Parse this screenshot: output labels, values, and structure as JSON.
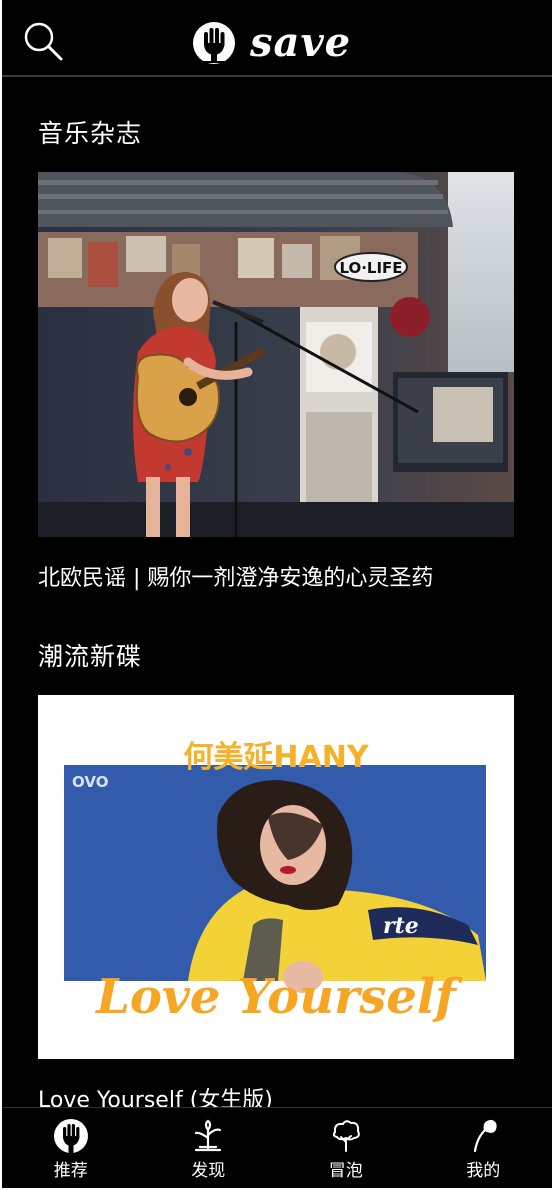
{
  "header": {
    "logo_text": "save",
    "search_icon": "search-icon",
    "logo_icon": "hand-logo-icon"
  },
  "sections": [
    {
      "title": "音乐杂志",
      "caption": "北欧民谣 | 赐你一剂澄净安逸的心灵圣药",
      "image_sign": "LO·LIFE"
    },
    {
      "title": "潮流新碟",
      "caption": "Love Yourself (女生版)",
      "cover_artist": "何美延HANY",
      "cover_title": "Love Yourself",
      "cover_badge": "OVO"
    }
  ],
  "tabbar": {
    "items": [
      {
        "label": "推荐",
        "icon": "hand-logo-icon"
      },
      {
        "label": "发现",
        "icon": "sprout-icon"
      },
      {
        "label": "冒泡",
        "icon": "tree-icon"
      },
      {
        "label": "我的",
        "icon": "leaf-icon"
      }
    ]
  },
  "colors": {
    "background": "#000000",
    "text": "#ffffff",
    "cover_yellow": "#f6b12a",
    "cover_blue": "#2d55a6"
  }
}
